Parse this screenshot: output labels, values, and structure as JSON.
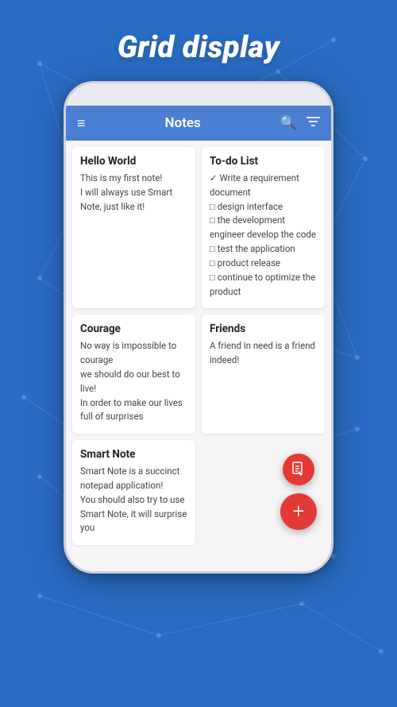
{
  "header": {
    "title": "Grid display"
  },
  "appbar": {
    "title": "Notes",
    "menu_icon": "≡",
    "search_icon": "🔍",
    "filter_icon": "⊟"
  },
  "notes": [
    {
      "id": "hello-world",
      "title": "Hello World",
      "body": "This is my first note!\nI will always use Smart Note, just like it!"
    },
    {
      "id": "todo-list",
      "title": "To-do List",
      "body": "✓ Write a requirement document\n□ design interface\n□ the development engineer develop the code\n□ test the application\n□ product release\n□ continue to optimize the product"
    },
    {
      "id": "courage",
      "title": "Courage",
      "body": "No way is impossible to courage\nwe should do our best to live!\nIn order to make our lives full of surprises"
    },
    {
      "id": "friends",
      "title": "Friends",
      "body": "A friend in need is a friend indeed!"
    },
    {
      "id": "smart-note",
      "title": "Smart Note",
      "body": "Smart Note is a succinct notepad application!\nYou should also try to use Smart Note, it will surprise you"
    }
  ],
  "fabs": {
    "document_icon": "📄",
    "add_icon": "+"
  }
}
